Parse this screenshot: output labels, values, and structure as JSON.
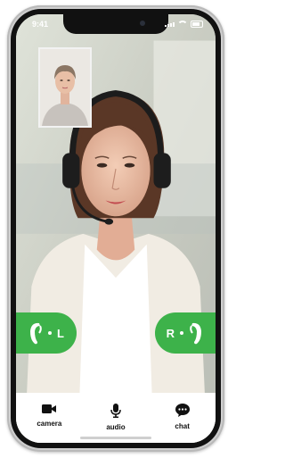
{
  "status": {
    "time": "9:41"
  },
  "pip": {
    "label": "self-view"
  },
  "hearing": {
    "left_label": "L",
    "right_label": "R"
  },
  "toolbar": {
    "camera_label": "camera",
    "audio_label": "audio",
    "chat_label": "chat"
  },
  "colors": {
    "accent_green": "#3db24a",
    "toolbar_bg": "#ffffff"
  }
}
